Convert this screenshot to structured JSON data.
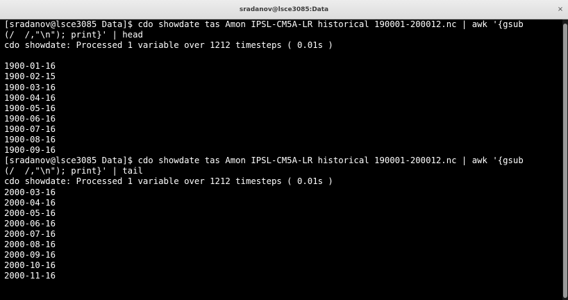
{
  "window": {
    "title": "sradanov@lsce3085:Data",
    "close_label": "×"
  },
  "terminal": {
    "lines": [
      "[sradanov@lsce3085 Data]$ cdo showdate tas Amon IPSL-CM5A-LR historical 190001-200012.nc | awk '{gsub",
      "(/  /,\"\\n\"); print}' | head",
      "cdo showdate: Processed 1 variable over 1212 timesteps ( 0.01s )",
      "",
      "1900-01-16",
      "1900-02-15",
      "1900-03-16",
      "1900-04-16",
      "1900-05-16",
      "1900-06-16",
      "1900-07-16",
      "1900-08-16",
      "1900-09-16",
      "[sradanov@lsce3085 Data]$ cdo showdate tas Amon IPSL-CM5A-LR historical 190001-200012.nc | awk '{gsub",
      "(/  /,\"\\n\"); print}' | tail",
      "cdo showdate: Processed 1 variable over 1212 timesteps ( 0.01s )",
      "2000-03-16",
      "2000-04-16",
      "2000-05-16",
      "2000-06-16",
      "2000-07-16",
      "2000-08-16",
      "2000-09-16",
      "2000-10-16",
      "2000-11-16"
    ]
  }
}
